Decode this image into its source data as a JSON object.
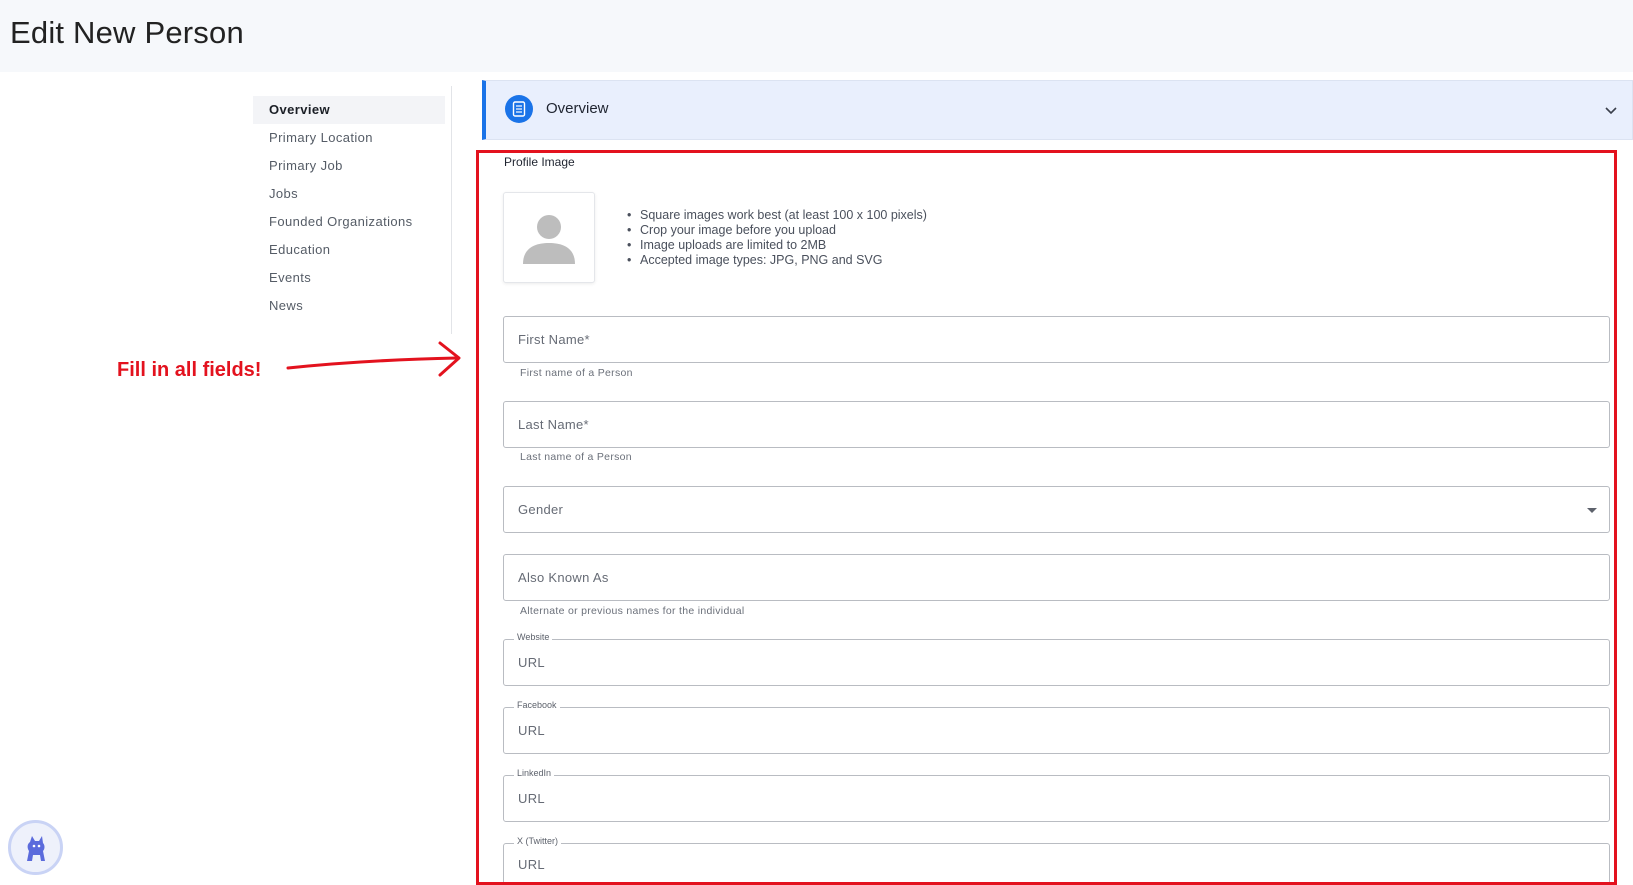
{
  "page": {
    "title": "Edit New Person"
  },
  "sidenav": {
    "items": [
      {
        "label": "Overview",
        "active": true
      },
      {
        "label": "Primary Location"
      },
      {
        "label": "Primary Job"
      },
      {
        "label": "Jobs"
      },
      {
        "label": "Founded Organizations"
      },
      {
        "label": "Education"
      },
      {
        "label": "Events"
      },
      {
        "label": "News"
      }
    ]
  },
  "annotation": {
    "text": "Fill in all fields!",
    "color": "#e3121e"
  },
  "panel": {
    "title": "Overview",
    "accent": "#1a73e8"
  },
  "profile_image": {
    "label": "Profile Image",
    "tips": [
      "Square images work best (at least 100 x 100 pixels)",
      "Crop your image before you upload",
      "Image uploads are limited to 2MB",
      "Accepted image types: JPG, PNG and SVG"
    ]
  },
  "form": {
    "first_name": {
      "placeholder": "First Name*",
      "helper": "First name of a Person"
    },
    "last_name": {
      "placeholder": "Last Name*",
      "helper": "Last name of a Person"
    },
    "gender": {
      "placeholder": "Gender"
    },
    "aka": {
      "placeholder": "Also Known As",
      "helper": "Alternate or previous names for the individual"
    },
    "website": {
      "label": "Website",
      "placeholder": "URL"
    },
    "facebook": {
      "label": "Facebook",
      "placeholder": "URL"
    },
    "linkedin": {
      "label": "LinkedIn",
      "placeholder": "URL"
    },
    "twitter": {
      "label": "X (Twitter)",
      "placeholder": "URL"
    }
  },
  "icons": {
    "panel": "document-icon",
    "chevron": "chevron-down-icon",
    "avatar": "person-placeholder-icon",
    "assistant": "dog-assistant-icon"
  }
}
